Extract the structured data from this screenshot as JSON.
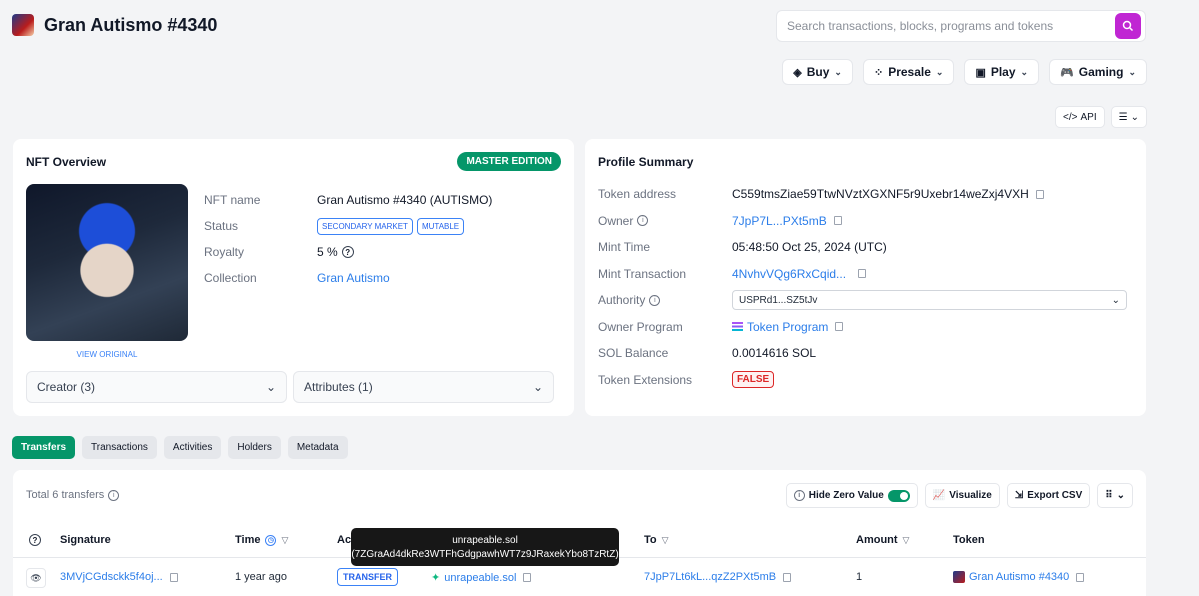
{
  "header": {
    "title": "Gran Autismo #4340",
    "search_placeholder": "Search transactions, blocks, programs and tokens"
  },
  "nav": [
    {
      "label": "Buy",
      "icon": "tag-icon"
    },
    {
      "label": "Presale",
      "icon": "presale-icon"
    },
    {
      "label": "Play",
      "icon": "play-icon"
    },
    {
      "label": "Gaming",
      "icon": "gamepad-icon"
    }
  ],
  "api_label": "API",
  "nft_overview": {
    "title": "NFT Overview",
    "badge": "MASTER EDITION",
    "view_original": "VIEW ORIGINAL",
    "name_label": "NFT name",
    "name_value": "Gran Autismo #4340 (AUTISMO)",
    "status_label": "Status",
    "status_tags": [
      "SECONDARY MARKET",
      "MUTABLE"
    ],
    "royalty_label": "Royalty",
    "royalty_value": "5 %",
    "collection_label": "Collection",
    "collection_value": "Gran Autismo",
    "creator_dropdown": "Creator (3)",
    "attributes_dropdown": "Attributes (1)"
  },
  "profile": {
    "title": "Profile Summary",
    "rows": [
      {
        "label": "Token address",
        "value": "C559tmsZiae59TtwNVztXGXNF5r9Uxebr14weZxj4VXH"
      },
      {
        "label": "Owner",
        "value": "7JpP7L...PXt5mB"
      },
      {
        "label": "Mint Time",
        "value": "05:48:50 Oct 25, 2024 (UTC)"
      },
      {
        "label": "Mint Transaction",
        "value": "4NvhvVQg6RxCqid..."
      },
      {
        "label": "Authority",
        "value": "USPRd1...SZ5tJv"
      },
      {
        "label": "Owner Program",
        "value": "Token Program"
      },
      {
        "label": "SOL Balance",
        "value": "0.0014616 SOL"
      },
      {
        "label": "Token Extensions",
        "value": "FALSE"
      }
    ]
  },
  "tabs": [
    "Transfers",
    "Transactions",
    "Activities",
    "Holders",
    "Metadata"
  ],
  "transfers": {
    "total": "Total 6 transfers",
    "hide_zero": "Hide Zero Value",
    "visualize": "Visualize",
    "export": "Export CSV",
    "columns": [
      "Signature",
      "Time",
      "Ac",
      "To",
      "Amount",
      "Token"
    ],
    "row": {
      "signature": "3MVjCGdsckk5f4oj...",
      "time": "1 year ago",
      "action": "TRANSFER",
      "from": "unrapeable.sol",
      "to": "7JpP7Lt6kL...qzZ2PXt5mB",
      "amount": "1",
      "token": "Gran Autismo #4340"
    }
  },
  "tooltip": {
    "line1": "unrapeable.sol",
    "line2": "(7ZGraAd4dkRe3WTFhGdgpawhWT7z9JRaxekYbo8TzRtZ)"
  },
  "colors": {
    "accent": "#059669",
    "link": "#2b7de9",
    "search_button": "#c026d3",
    "danger": "#dc2626"
  }
}
